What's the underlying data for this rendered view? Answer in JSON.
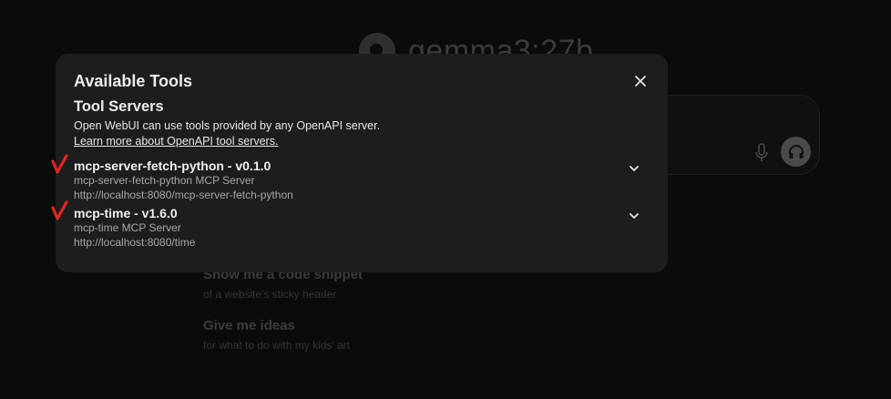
{
  "background": {
    "model_name": "gemma3:27b",
    "suggestions": [
      {
        "title": "Show me a code snippet",
        "subtitle": "of a website's sticky header"
      },
      {
        "title": "Give me ideas",
        "subtitle": "for what to do with my kids' art"
      }
    ]
  },
  "modal": {
    "title": "Available Tools",
    "section_title": "Tool Servers",
    "description": "Open WebUI can use tools provided by any OpenAPI server.",
    "learn_more": "Learn more about OpenAPI tool servers.",
    "servers": [
      {
        "name": "mcp-server-fetch-python - v0.1.0",
        "description": "mcp-server-fetch-python MCP Server",
        "url": "http://localhost:8080/mcp-server-fetch-python"
      },
      {
        "name": "mcp-time - v1.6.0",
        "description": "mcp-time MCP Server",
        "url": "http://localhost:8080/time"
      }
    ]
  },
  "icons": {
    "close": "close-icon",
    "chevron": "chevron-down-icon",
    "mic": "mic-icon",
    "headphones": "headphones-icon",
    "annotation": "red-check-mark"
  },
  "colors": {
    "modal_bg": "#1d1d1d",
    "page_bg": "#0b0b0b",
    "annotation_red": "#e0261f"
  }
}
